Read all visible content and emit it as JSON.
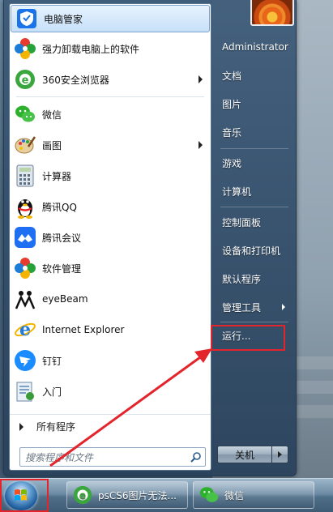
{
  "start_menu": {
    "programs": [
      {
        "label": "电脑管家",
        "icon": "shield-icon",
        "has_submenu": false
      },
      {
        "label": "强力卸载电脑上的软件",
        "icon": "clover-icon",
        "has_submenu": false
      },
      {
        "label": "360安全浏览器",
        "icon": "browser-icon",
        "has_submenu": true
      },
      {
        "label": "微信",
        "icon": "wechat-icon",
        "has_submenu": false
      },
      {
        "label": "画图",
        "icon": "paint-icon",
        "has_submenu": true
      },
      {
        "label": "计算器",
        "icon": "calculator-icon",
        "has_submenu": false
      },
      {
        "label": "腾讯QQ",
        "icon": "qq-penguin-icon",
        "has_submenu": false
      },
      {
        "label": "腾讯会议",
        "icon": "meeting-icon",
        "has_submenu": false
      },
      {
        "label": "软件管理",
        "icon": "clover-icon",
        "has_submenu": false
      },
      {
        "label": "eyeBeam",
        "icon": "eyebeam-icon",
        "has_submenu": false
      },
      {
        "label": "Internet Explorer",
        "icon": "ie-icon",
        "has_submenu": false
      },
      {
        "label": "钉钉",
        "icon": "dingtalk-icon",
        "has_submenu": false
      },
      {
        "label": "入门",
        "icon": "getting-started-icon",
        "has_submenu": false
      }
    ],
    "all_programs_label": "所有程序",
    "search_placeholder": "搜索程序和文件",
    "right_items": [
      {
        "label": "Administrator",
        "has_submenu": false
      },
      {
        "label": "文档",
        "has_submenu": false
      },
      {
        "label": "图片",
        "has_submenu": false
      },
      {
        "label": "音乐",
        "has_submenu": false
      },
      {
        "label": "游戏",
        "has_submenu": false
      },
      {
        "label": "计算机",
        "has_submenu": false
      },
      {
        "label": "控制面板",
        "has_submenu": false
      },
      {
        "label": "设备和打印机",
        "has_submenu": false
      },
      {
        "label": "默认程序",
        "has_submenu": false
      },
      {
        "label": "管理工具",
        "has_submenu": true
      },
      {
        "label": "运行...",
        "has_submenu": false
      }
    ],
    "shutdown_label": "关机"
  },
  "taskbar": {
    "items": [
      {
        "label": "psCS6图片无法...",
        "icon": "browser-icon"
      },
      {
        "label": "微信",
        "icon": "wechat-icon"
      }
    ]
  },
  "colors": {
    "annotation_red": "#e4242b",
    "highlight_blue": "#c7e0f9"
  }
}
